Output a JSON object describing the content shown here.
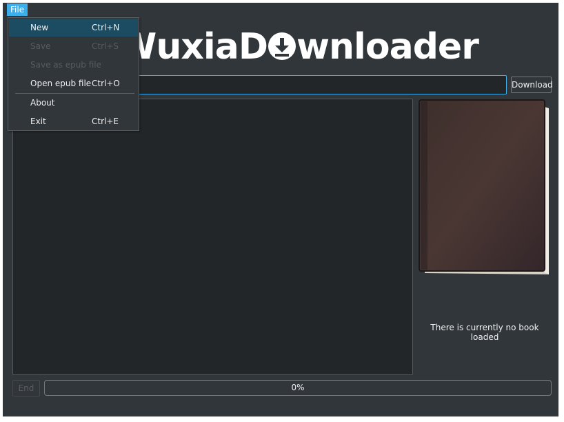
{
  "menubar": {
    "file": "File"
  },
  "menu": {
    "new": {
      "label": "New",
      "shortcut": "Ctrl+N"
    },
    "save": {
      "label": "Save",
      "shortcut": "Ctrl+S"
    },
    "save_epub": {
      "label": "Save as epub file"
    },
    "open_epub": {
      "label": "Open epub file",
      "shortcut": "Ctrl+O"
    },
    "about": {
      "label": "About"
    },
    "exit": {
      "label": "Exit",
      "shortcut": "Ctrl+E"
    }
  },
  "logo": {
    "part1": "W",
    "part2": "uxiaD",
    "part3": "wnloader"
  },
  "url_input": {
    "value": ""
  },
  "download_button": "Download",
  "book": {
    "status": "There is currently no book loaded"
  },
  "end_button": "End",
  "progress": {
    "label": "0%",
    "fraction": 0
  },
  "colors": {
    "accent": "#3daee9",
    "background": "#31363b",
    "field": "#232629"
  }
}
